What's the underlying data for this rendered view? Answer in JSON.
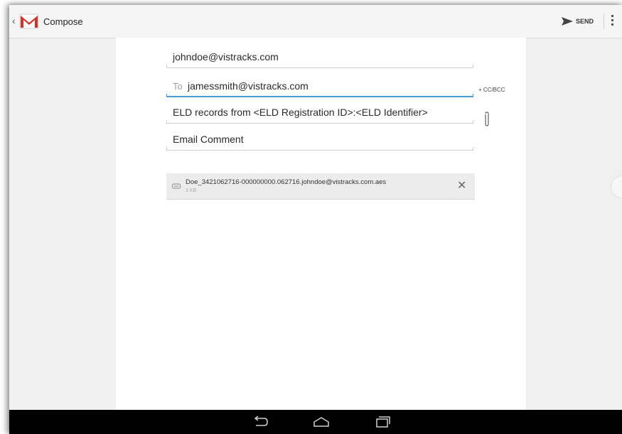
{
  "app": {
    "title": "Compose",
    "up_caret": "‹",
    "send_label": "SEND"
  },
  "compose": {
    "from": "johndoe@vistracks.com",
    "to_label": "To",
    "to_value": "jamessmith@vistracks.com",
    "cc_bcc_label": "+ CC/BCC",
    "subject": "ELD records from <ELD Registration ID>:<ELD Identifier>",
    "body": "Email Comment"
  },
  "attachment": {
    "filename": "Doe_3421062716-000000000.062716.johndoe@vistracks.com.aes",
    "size": "3 KB",
    "close_glyph": "✕"
  },
  "icons": {
    "gmail": "gmail-icon",
    "send": "send-icon",
    "overflow": "overflow-menu-icon",
    "attach": "paperclip-icon",
    "back": "back-icon",
    "home": "home-icon",
    "recents": "recents-icon"
  },
  "colors": {
    "accent": "#4a9fd8",
    "gmail_red": "#d93025",
    "navbar": "#000000"
  }
}
